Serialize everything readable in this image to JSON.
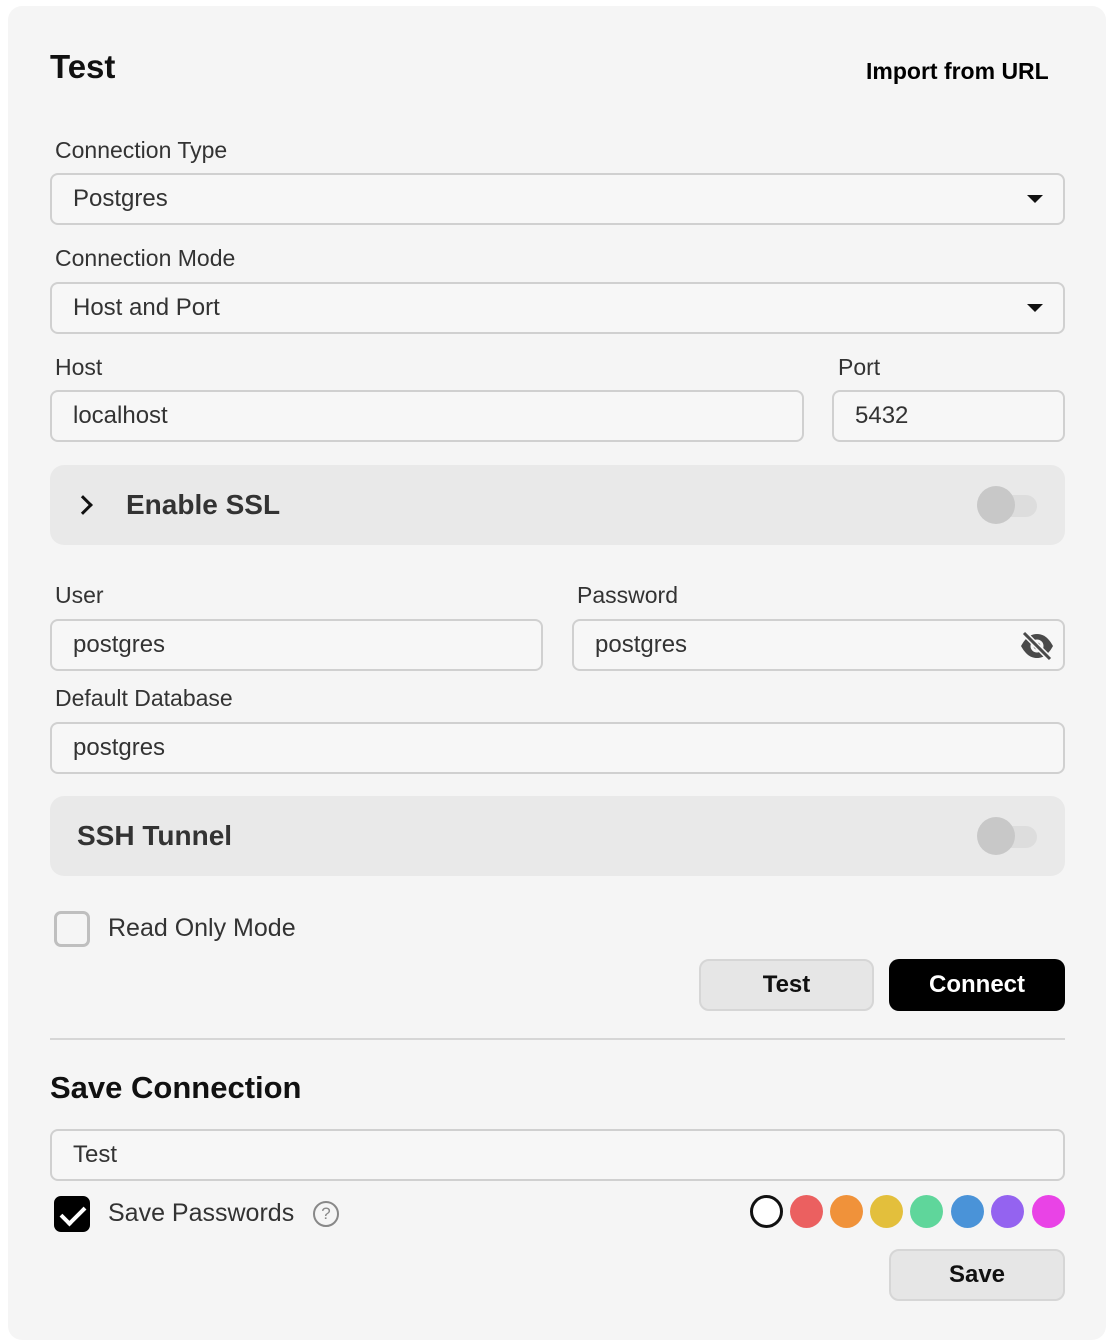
{
  "header": {
    "title": "Test",
    "import_link": "Import from URL"
  },
  "connection_type": {
    "label": "Connection Type",
    "value": "Postgres"
  },
  "connection_mode": {
    "label": "Connection Mode",
    "value": "Host and Port"
  },
  "host": {
    "label": "Host",
    "value": "localhost"
  },
  "port": {
    "label": "Port",
    "value": "5432"
  },
  "ssl": {
    "label": "Enable SSL",
    "enabled": false
  },
  "user": {
    "label": "User",
    "value": "postgres"
  },
  "password": {
    "label": "Password",
    "value": "postgres",
    "icon": "eye-off-icon"
  },
  "default_database": {
    "label": "Default Database",
    "value": "postgres"
  },
  "ssh": {
    "label": "SSH Tunnel",
    "enabled": false
  },
  "read_only": {
    "label": "Read Only Mode",
    "checked": false
  },
  "actions": {
    "test_label": "Test",
    "connect_label": "Connect"
  },
  "save_connection": {
    "title": "Save Connection",
    "name_value": "Test",
    "save_passwords_label": "Save Passwords",
    "save_passwords_checked": true,
    "help_icon": "?",
    "colors": [
      "none",
      "#eb6060",
      "#f0923a",
      "#e3bf3c",
      "#5fd69b",
      "#4a93d8",
      "#9463f0",
      "#e943e6"
    ],
    "save_label": "Save"
  }
}
